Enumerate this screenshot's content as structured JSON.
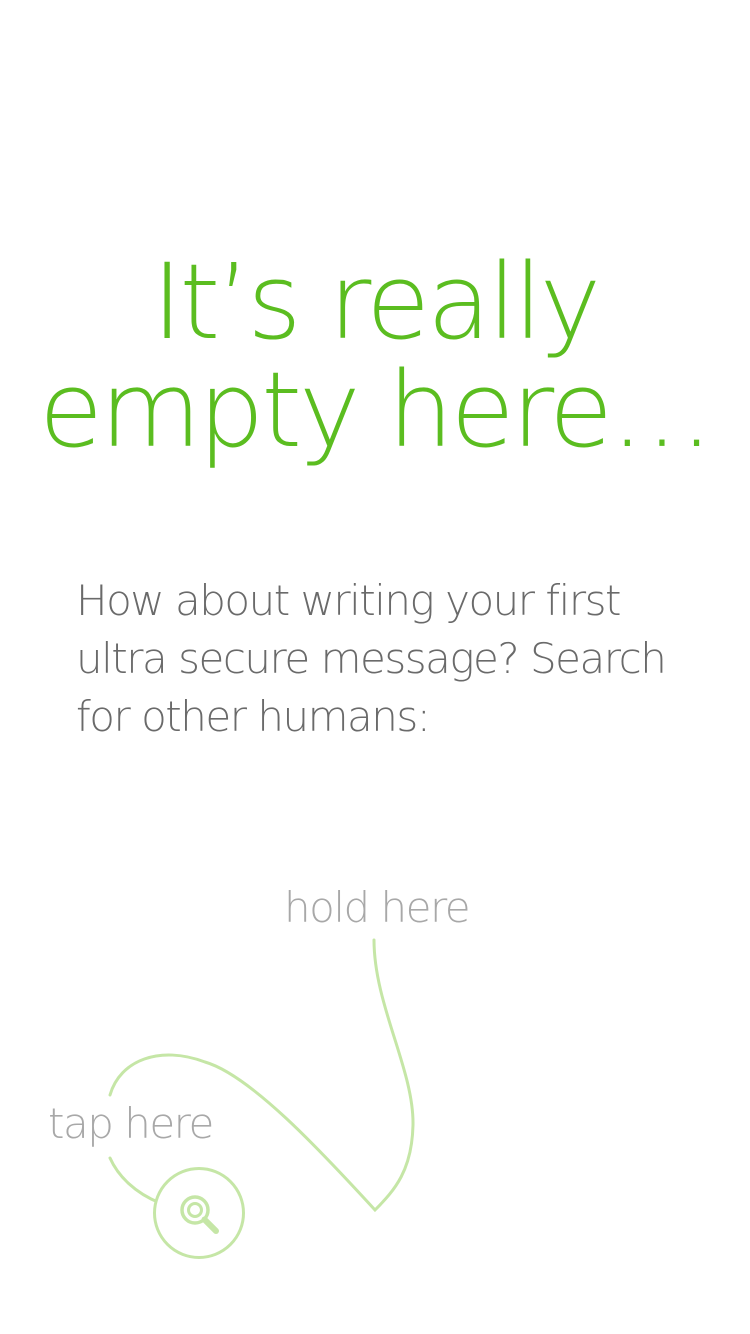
{
  "empty_state": {
    "headline_line1": "It’s really",
    "headline_line2": "empty here…",
    "message": "How about writing your first ultra secure message? Search for other humans:"
  },
  "hints": {
    "hold_label": "hold here",
    "tap_label": "tap here"
  },
  "search_button": {
    "icon": "search-icon"
  },
  "colors": {
    "accent_green": "#5bbd20",
    "guide_line": "#c5e6a6",
    "body_text": "#6a6a6a",
    "hint_text": "#a8a8a8",
    "background": "#ffffff"
  }
}
